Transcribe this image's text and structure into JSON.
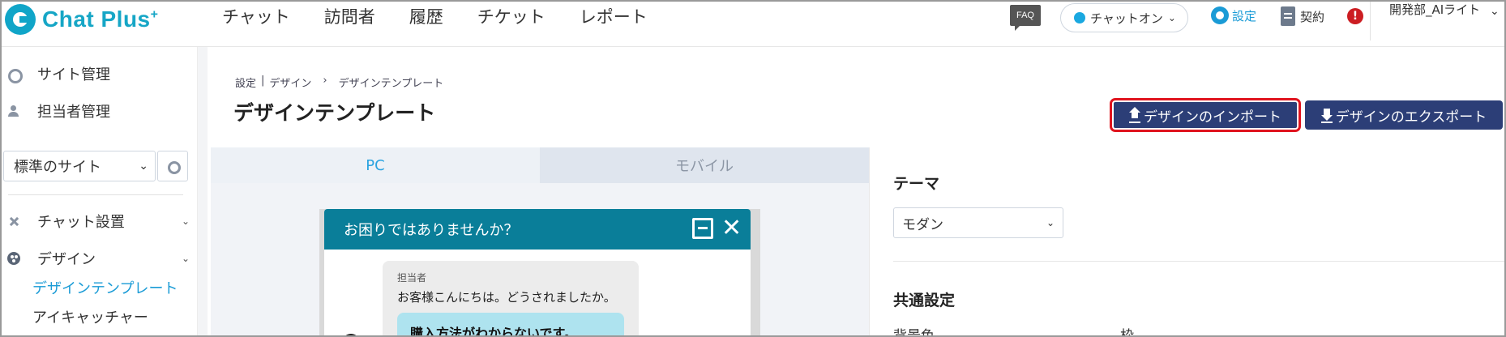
{
  "app": {
    "logo_text": "Chat Plus",
    "logo_sup": "+"
  },
  "nav": {
    "items": [
      "チャット",
      "訪問者",
      "履歴",
      "チケット",
      "レポート"
    ]
  },
  "header": {
    "faq_label": "FAQ",
    "status_label": "チャットオン",
    "settings_label": "設定",
    "contract_label": "契約",
    "alert_label": "!",
    "user_name": "開発部_AIライト"
  },
  "sidebar": {
    "site_management": "サイト管理",
    "staff_management": "担当者管理",
    "site_select_value": "標準のサイト",
    "chat_setup": "チャット設置",
    "design": "デザイン",
    "design_template": "デザインテンプレート",
    "eye_catcher": "アイキャッチャー"
  },
  "breadcrumb": {
    "part1": "設定",
    "sep1": "|",
    "part2": "デザイン",
    "sep2": "›",
    "part3": "デザインテンプレート"
  },
  "page": {
    "title": "デザインテンプレート",
    "import_button": "デザインのインポート",
    "export_button": "デザインのエクスポート"
  },
  "preview": {
    "tab_pc": "PC",
    "tab_mobile": "モバイル",
    "widget_title": "お困りではありませんか？",
    "close_glyph": "✕",
    "message_sender": "担当者",
    "message_text": "お客様こんにちは。どうされましたか。",
    "quick_reply": "購入方法がわからないです。"
  },
  "settings_panel": {
    "theme_title": "テーマ",
    "theme_value": "モダン",
    "common_title": "共通設定",
    "bg_color_label": "背景色",
    "frame_label": "枠"
  },
  "colors": {
    "brand": "#16a6c6",
    "primary_button": "#2c3e77",
    "highlight": "#e0141e",
    "widget_header": "#0a7e99",
    "active_link": "#1a9bd6"
  }
}
